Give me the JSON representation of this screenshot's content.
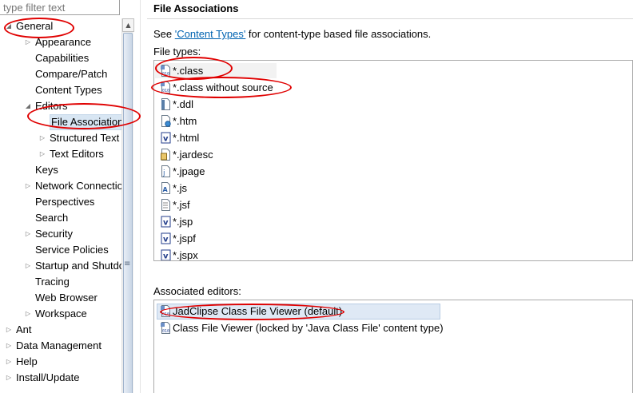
{
  "filter": {
    "placeholder": "type filter text"
  },
  "tree": {
    "items": [
      {
        "label": "General",
        "indent": 0,
        "twisty": "expanded"
      },
      {
        "label": "Appearance",
        "indent": 1,
        "twisty": "collapsed"
      },
      {
        "label": "Capabilities",
        "indent": 1,
        "twisty": "none"
      },
      {
        "label": "Compare/Patch",
        "indent": 1,
        "twisty": "none"
      },
      {
        "label": "Content Types",
        "indent": 1,
        "twisty": "none"
      },
      {
        "label": "Editors",
        "indent": 1,
        "twisty": "expanded"
      },
      {
        "label": "File Associations",
        "indent": 2,
        "twisty": "none",
        "selected": true
      },
      {
        "label": "Structured Text Editors",
        "indent": 2,
        "twisty": "collapsed"
      },
      {
        "label": "Text Editors",
        "indent": 2,
        "twisty": "collapsed"
      },
      {
        "label": "Keys",
        "indent": 1,
        "twisty": "none"
      },
      {
        "label": "Network Connections",
        "indent": 1,
        "twisty": "collapsed"
      },
      {
        "label": "Perspectives",
        "indent": 1,
        "twisty": "none"
      },
      {
        "label": "Search",
        "indent": 1,
        "twisty": "none"
      },
      {
        "label": "Security",
        "indent": 1,
        "twisty": "collapsed"
      },
      {
        "label": "Service Policies",
        "indent": 1,
        "twisty": "none"
      },
      {
        "label": "Startup and Shutdown",
        "indent": 1,
        "twisty": "collapsed"
      },
      {
        "label": "Tracing",
        "indent": 1,
        "twisty": "none"
      },
      {
        "label": "Web Browser",
        "indent": 1,
        "twisty": "none"
      },
      {
        "label": "Workspace",
        "indent": 1,
        "twisty": "collapsed"
      },
      {
        "label": "Ant",
        "indent": 0,
        "twisty": "collapsed"
      },
      {
        "label": "Data Management",
        "indent": 0,
        "twisty": "collapsed"
      },
      {
        "label": "Help",
        "indent": 0,
        "twisty": "collapsed"
      },
      {
        "label": "Install/Update",
        "indent": 0,
        "twisty": "collapsed"
      }
    ]
  },
  "main": {
    "title": "File Associations",
    "see_prefix": "See ",
    "see_link": "'Content Types'",
    "see_suffix": " for content-type based file associations.",
    "file_types_label": "File types:",
    "file_types": [
      {
        "label": "*.class",
        "icon": "class-file-icon"
      },
      {
        "label": "*.class without source",
        "icon": "class-file-icon"
      },
      {
        "label": "*.ddl",
        "icon": "ddl-file-icon"
      },
      {
        "label": "*.htm",
        "icon": "htm-file-icon"
      },
      {
        "label": "*.html",
        "icon": "v-file-icon"
      },
      {
        "label": "*.jardesc",
        "icon": "jardesc-file-icon"
      },
      {
        "label": "*.jpage",
        "icon": "jpage-file-icon"
      },
      {
        "label": "*.js",
        "icon": "js-file-icon"
      },
      {
        "label": "*.jsf",
        "icon": "text-file-icon"
      },
      {
        "label": "*.jsp",
        "icon": "v-file-icon"
      },
      {
        "label": "*.jspf",
        "icon": "v-file-icon"
      },
      {
        "label": "*.jspx",
        "icon": "v-file-icon"
      }
    ],
    "associated_editors_label": "Associated editors:",
    "associated_editors": [
      {
        "label": "JadClipse Class File Viewer (default)",
        "icon": "class-file-icon"
      },
      {
        "label": "Class File Viewer (locked by 'Java Class File' content type)",
        "icon": "class-file-icon"
      }
    ]
  },
  "colors": {
    "link": "#0063b1",
    "annotation": "#e00000",
    "selection": "#d8e6f3"
  }
}
